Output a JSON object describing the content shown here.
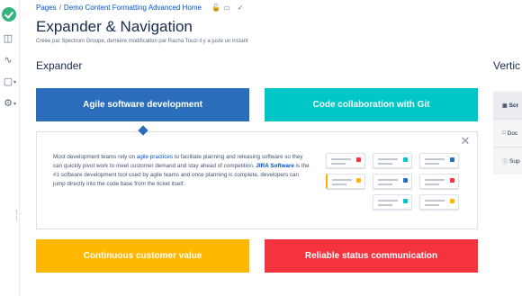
{
  "breadcrumb": {
    "items": [
      "Pages",
      "Demo Content Formatting Advanced Home"
    ],
    "separator": "/"
  },
  "page": {
    "title": "Expander & Navigation",
    "byline": "Créée par Spectrum Groupe, dernière modification par Racha Touzi il y a juste un instant"
  },
  "expander": {
    "heading": "Expander",
    "tabs": {
      "agile": "Agile software development",
      "git": "Code collaboration with Git",
      "value": "Continuous customer value",
      "status": "Reliable status communication"
    },
    "content": {
      "part1": "Most development teams rely on ",
      "link": "agile practices",
      "part2": " to facilitate planning and releasing software so they can quickly pivot work to meet customer demand and stay ahead of competition. ",
      "brand": "JIRA Software",
      "part3": " is the #1 software development tool used by agile teams and once planning is complete, developers can jump directly into the code base from the ticket itself."
    }
  },
  "vertical": {
    "heading": "Vertic",
    "items": [
      "Scr",
      "Doc",
      "Sup"
    ]
  },
  "colors": {
    "blue": "#2a6ebb",
    "teal": "#00c7c7",
    "yellow": "#ffb800",
    "red": "#f5333f",
    "link": "#0052cc"
  },
  "icons": [
    "lock-icon",
    "watch-icon",
    "share-icon",
    "close-icon",
    "app-logo-icon"
  ]
}
